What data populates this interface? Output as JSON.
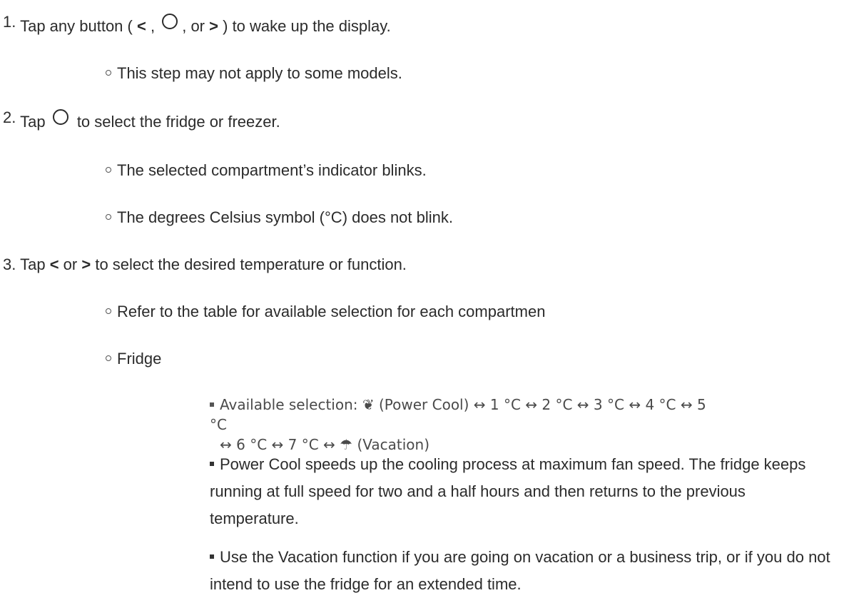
{
  "steps": [
    {
      "number": "1.",
      "text_before": "Tap any button (",
      "lt": "<",
      "comma1": ",",
      "comma2": ", or",
      "gt": ">",
      "text_after": ") to wake up the display."
    },
    {
      "number": "2.",
      "text_before": "Tap",
      "text_after": "to select the fridge or freezer."
    },
    {
      "number": "3.",
      "text_before": "Tap",
      "lt": "<",
      "or": "or",
      "gt": ">",
      "text_after": "to select the desired temperature or function."
    }
  ],
  "sub_items": {
    "s1_note": "This step may not apply to some models.",
    "s2_blink": "The selected compartment’s indicator blinks.",
    "s2_celsius": "The degrees Celsius symbol (°C) does not blink.",
    "s3_table": "Refer to the table for available selection for each compartmen",
    "s3_fridge": "Fridge"
  },
  "fridge": {
    "available_line1": "Available selection: ❦ (Power Cool) ↔ 1 °C ↔ 2 °C ↔ 3 °C ↔ 4 °C ↔ 5 °C",
    "available_line2": "↔ 6 °C ↔ 7 °C ↔ ☂ (Vacation)",
    "power_cool": "Power Cool speeds up the cooling process at maximum fan speed. The fridge keeps running at full speed for two and a half hours and then returns to the previous temperature.",
    "vacation": "Use the Vacation function if you are going on vacation or a business trip, or if you do not intend to use the fridge for an extended time."
  },
  "icons": {
    "select": "circle-button-icon"
  }
}
